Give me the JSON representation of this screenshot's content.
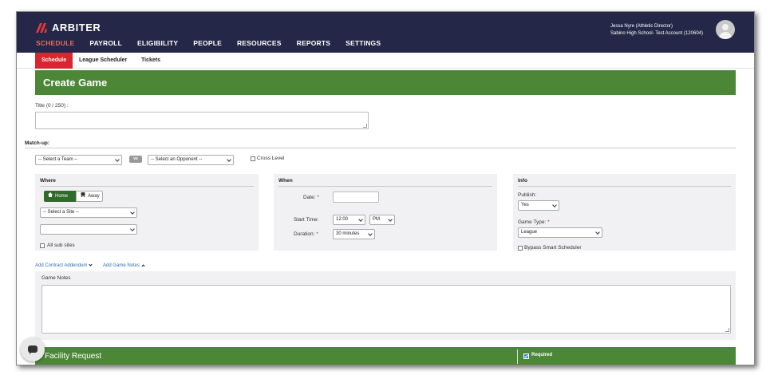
{
  "app": {
    "logo_text": "ARBITER"
  },
  "main_nav": [
    {
      "label": "SCHEDULE"
    },
    {
      "label": "PAYROLL"
    },
    {
      "label": "ELIGIBILITY"
    },
    {
      "label": "PEOPLE"
    },
    {
      "label": "RESOURCES"
    },
    {
      "label": "REPORTS"
    },
    {
      "label": "SETTINGS"
    }
  ],
  "user": {
    "name": "Jessa Nyre (Athletic Director)",
    "account": "Sabino High School- Test Account (120604)"
  },
  "sub_nav": [
    {
      "label": "Schedule"
    },
    {
      "label": "League Scheduler"
    },
    {
      "label": "Tickets"
    }
  ],
  "page": {
    "title": "Create Game"
  },
  "form": {
    "title_label": "Title (0 / 250) :",
    "title_value": "",
    "matchup_label": "Match-up:",
    "team_select": "-- Select a Team --",
    "vs_label": "vs",
    "opponent_select": "-- Select an Opponent --",
    "cross_level_label": "Cross Level"
  },
  "where": {
    "title": "Where",
    "home_label": "Home",
    "away_label": "Away",
    "site_select": "-- Select a Site --",
    "subsite_select": "",
    "all_sub_sites_label": "All sub sites"
  },
  "when": {
    "title": "When",
    "date_label": "Date:",
    "date_required": "*",
    "date_value": "",
    "start_time_label": "Start Time:",
    "start_time_value": "12:00",
    "ampm_value": "PM",
    "duration_label": "Duration:",
    "duration_required": "*",
    "duration_value": "30 minutes"
  },
  "info": {
    "title": "Info",
    "publish_label": "Publish:",
    "publish_value": "Yes",
    "game_type_label": "Game Type:",
    "game_type_required": "*",
    "game_type_value": "League",
    "bypass_label": "Bypass Smart Scheduler"
  },
  "links": {
    "contract_addendum": "Add Contract Addendum",
    "game_notes": "Add Game Notes"
  },
  "notes": {
    "label": "Game Notes",
    "value": ""
  },
  "facility": {
    "title": "Facility Request",
    "required_label": "Required"
  },
  "colors": {
    "header_bg": "#242747",
    "accent_green": "#4b8737",
    "active_red": "#d9262e",
    "nav_active": "#e36a64"
  }
}
